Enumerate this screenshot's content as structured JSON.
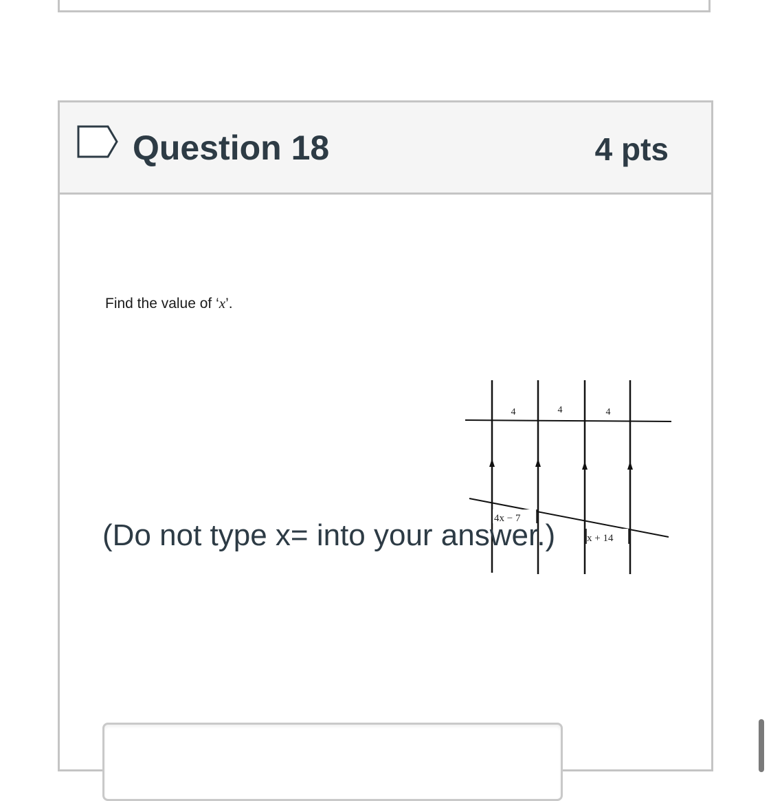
{
  "question": {
    "title": "Question 18",
    "points": "4 pts",
    "prompt_prefix": "Find the value of ‘",
    "prompt_var": "x",
    "prompt_suffix": "’.",
    "instruction": "(Do not type x= into your answer.)",
    "answer_value": ""
  },
  "figure": {
    "top_segment_labels": [
      "4",
      "4",
      "4"
    ],
    "left_expression": "4x − 7",
    "right_expression": "x + 14"
  },
  "icons": {
    "flag": "flag-question-icon"
  },
  "colors": {
    "border": "#c4c4c4",
    "header_bg": "#f5f5f5",
    "text": "#2d3b45",
    "flag": "#2d3b45"
  }
}
